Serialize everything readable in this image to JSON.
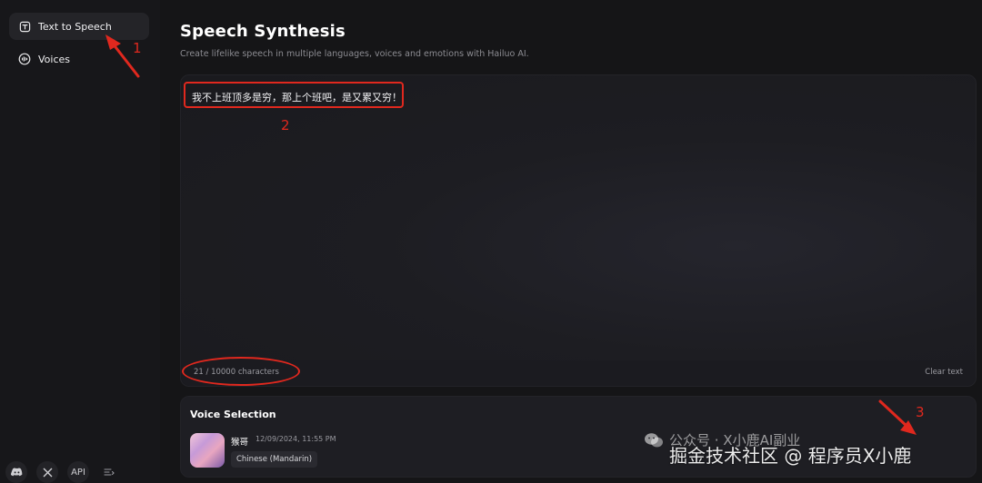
{
  "sidebar": {
    "items": [
      {
        "label": "Text to Speech",
        "icon": "text-to-speech-icon",
        "active": true
      },
      {
        "label": "Voices",
        "icon": "voices-icon",
        "active": false
      }
    ],
    "bottom": {
      "discord_icon": "discord-icon",
      "x_icon": "x-icon",
      "api_label": "API",
      "menu_icon": "menu-icon"
    }
  },
  "header": {
    "title": "Speech Synthesis",
    "subtitle": "Create lifelike speech in multiple languages, voices and emotions with Hailuo AI."
  },
  "editor": {
    "text": "我不上班顶多是穷，那上个班吧，是又累又穷！",
    "char_count": "21 / 10000 characters",
    "clear_label": "Clear text"
  },
  "voice_selection": {
    "title": "Voice Selection",
    "voice_name": "猴哥",
    "voice_date": "12/09/2024, 11:55 PM",
    "language_tag": "Chinese (Mandarin)"
  },
  "annotations": {
    "n1": "1",
    "n2": "2",
    "n3": "3",
    "color": "#e0281e"
  },
  "watermark": {
    "line1": "公众号 · X小鹿AI副业",
    "line2": "掘金技术社区 @ 程序员X小鹿"
  }
}
